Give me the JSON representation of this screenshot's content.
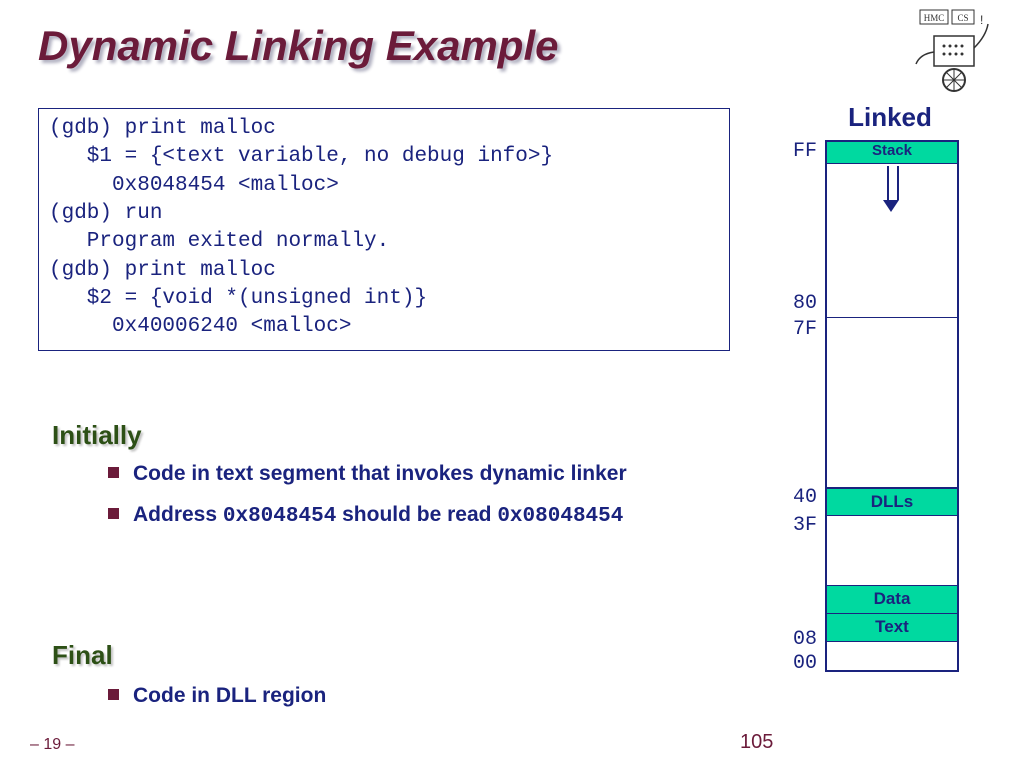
{
  "title": "Dynamic Linking Example",
  "code": {
    "l1": "(gdb) print malloc",
    "l2": "   $1 = {<text variable, no debug info>}",
    "l3": "     0x8048454 <malloc>",
    "l4": "(gdb) run",
    "l5": "   Program exited normally.",
    "l6": "(gdb) print malloc",
    "l7": "   $2 = {void *(unsigned int)}",
    "l8": "     0x40006240 <malloc>"
  },
  "sections": {
    "initially": "Initially",
    "final": "Final"
  },
  "bullets": {
    "b1": "Code in text segment that invokes dynamic linker",
    "b2a": "Address ",
    "b2b": "0x8048454",
    "b2c": " should be read ",
    "b2d": "0x08048454",
    "b3": "Code in DLL region"
  },
  "diagram": {
    "title": "Linked",
    "stack": "Stack",
    "dlls": "DLLs",
    "data": "Data",
    "text": "Text",
    "addr": {
      "ff": "FF",
      "80": "80",
      "7f": "7F",
      "40": "40",
      "3f": "3F",
      "08": "08",
      "00": "00"
    }
  },
  "pages": {
    "left": "– 19 –",
    "right": "105"
  }
}
